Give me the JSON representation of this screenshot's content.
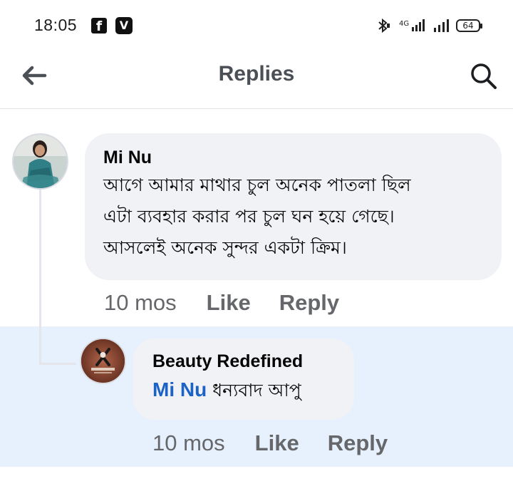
{
  "status_bar": {
    "time": "18:05",
    "fb_icon": "f",
    "v_icon": "V",
    "battery": "64",
    "icons": [
      "bluetooth-icon",
      "4g-signal-icon",
      "signal-bars-icon",
      "battery-icon"
    ]
  },
  "header": {
    "title": "Replies",
    "back_icon": "arrow-left-icon",
    "search_icon": "search-icon"
  },
  "comment": {
    "author": "Mi Nu",
    "lines": [
      "আগে আমার মাথার চুল অনেক পাতলা ছিল",
      "এটা ব্যবহার করার পর চুল ঘন হয়ে গেছে।",
      "আসলেই অনেক সুন্দর একটা ক্রিম।"
    ],
    "time": "10 mos",
    "like_label": "Like",
    "reply_label": "Reply"
  },
  "reply": {
    "author": "Beauty Redefined",
    "mention": "Mi Nu",
    "text": " ধন্যবাদ আপু",
    "time": "10 mos",
    "like_label": "Like",
    "reply_label": "Reply",
    "avatar_logo_text": "BEAUTY REDEFINED"
  },
  "colors": {
    "mention_blue": "#1b63c6",
    "highlight_bg": "#e7f0fd",
    "bubble_bg": "#f0f2f5",
    "meta_gray": "#65676b"
  }
}
